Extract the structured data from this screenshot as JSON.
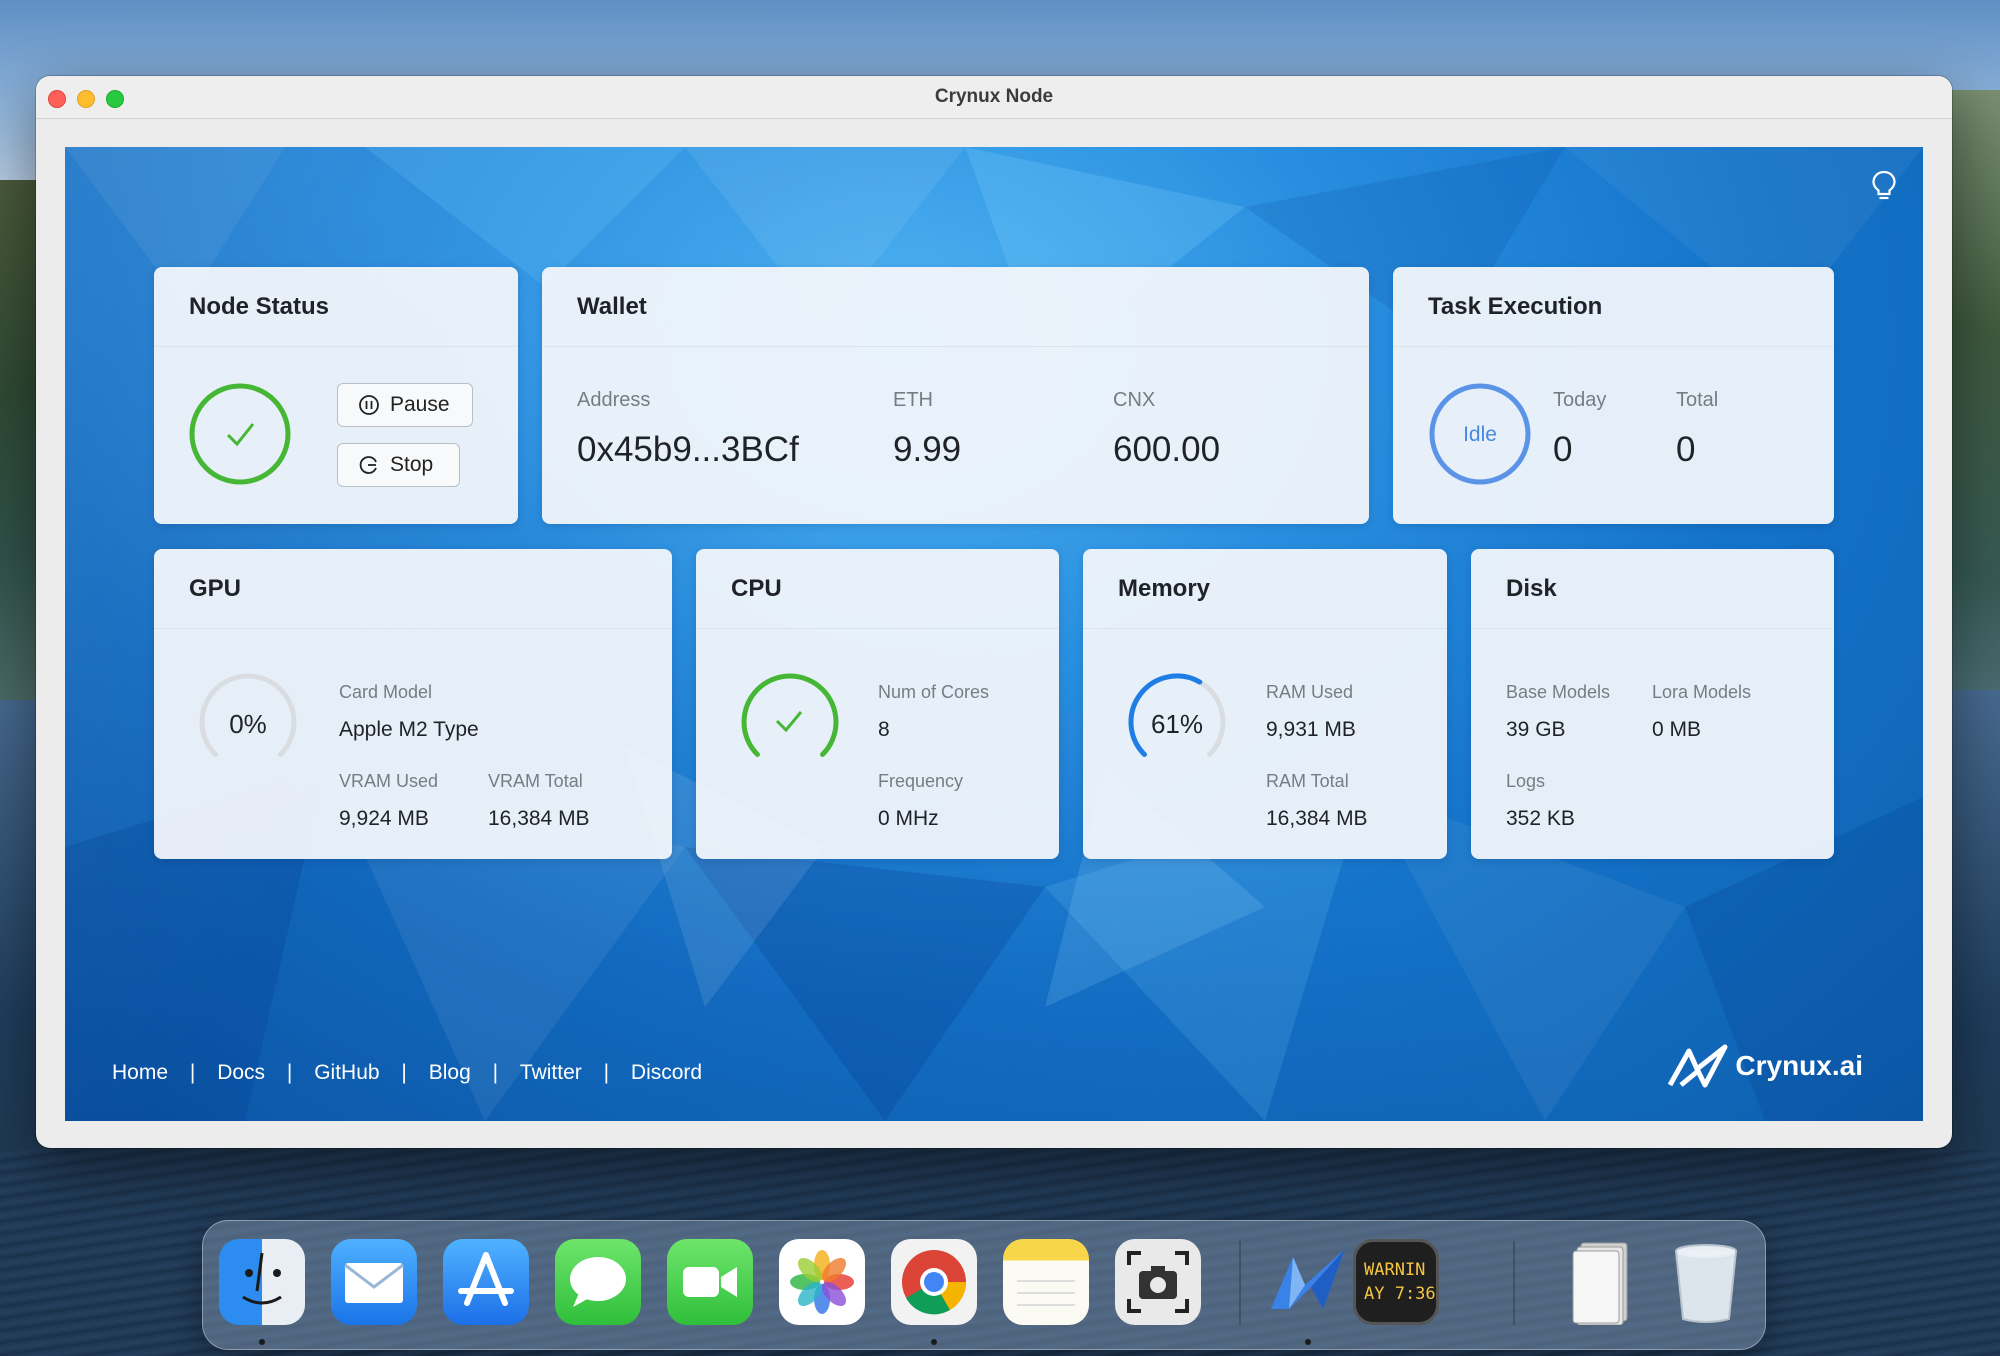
{
  "window": {
    "title": "Crynux Node"
  },
  "node_status": {
    "title": "Node Status",
    "pause_label": "Pause",
    "stop_label": "Stop"
  },
  "wallet": {
    "title": "Wallet",
    "address_label": "Address",
    "address_value": "0x45b9...3BCf",
    "eth_label": "ETH",
    "eth_value": "9.99",
    "cnx_label": "CNX",
    "cnx_value": "600.00"
  },
  "task_execution": {
    "title": "Task Execution",
    "state": "Idle",
    "today_label": "Today",
    "today_value": "0",
    "total_label": "Total",
    "total_value": "0"
  },
  "gpu": {
    "title": "GPU",
    "usage": "0%",
    "usage_fraction": 0,
    "card_model_label": "Card Model",
    "card_model_value": "Apple M2 Type",
    "vram_used_label": "VRAM Used",
    "vram_used_value": "9,924 MB",
    "vram_total_label": "VRAM Total",
    "vram_total_value": "16,384 MB"
  },
  "cpu": {
    "title": "CPU",
    "cores_label": "Num of Cores",
    "cores_value": "8",
    "frequency_label": "Frequency",
    "frequency_value": "0 MHz"
  },
  "memory": {
    "title": "Memory",
    "usage": "61%",
    "usage_fraction": 0.61,
    "ram_used_label": "RAM Used",
    "ram_used_value": "9,931 MB",
    "ram_total_label": "RAM Total",
    "ram_total_value": "16,384 MB"
  },
  "disk": {
    "title": "Disk",
    "base_models_label": "Base Models",
    "base_models_value": "39 GB",
    "lora_models_label": "Lora Models",
    "lora_models_value": "0 MB",
    "logs_label": "Logs",
    "logs_value": "352 KB"
  },
  "footer": {
    "links": [
      "Home",
      "Docs",
      "GitHub",
      "Blog",
      "Twitter",
      "Discord"
    ],
    "separator": "|",
    "brand": "Crynux.ai"
  },
  "dock": {
    "console_text_line1": "WARNIN",
    "console_text_line2": "AY 7:36",
    "apps": [
      "finder-icon",
      "mail-icon",
      "app-store-icon",
      "messages-icon",
      "facetime-icon",
      "photos-icon",
      "chrome-icon",
      "notes-icon",
      "screenshot-icon",
      "crynux-icon",
      "console-icon",
      "downloads-stack-icon",
      "trash-icon"
    ]
  },
  "colors": {
    "ok_green": "#45b735",
    "idle_blue": "#5b93e6",
    "gauge_blue": "#1e7ee6",
    "gauge_track": "#d9dde2"
  }
}
